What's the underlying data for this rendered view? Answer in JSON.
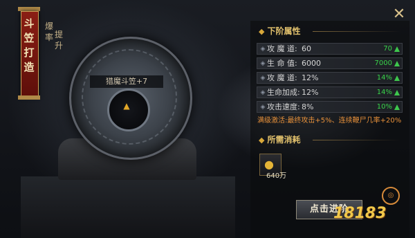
{
  "banner": {
    "title": "斗笠打造"
  },
  "subtitle": {
    "line1": "爆率",
    "line2": "提升"
  },
  "item": {
    "name": "猎魔斗笠+7",
    "icon": "hat-icon"
  },
  "next_attrs": {
    "title": "下阶属性",
    "rows": [
      {
        "label": "攻 魔 道:",
        "value": "60",
        "bonus": "70"
      },
      {
        "label": "生 命 值:",
        "value": "6000",
        "bonus": "7000"
      },
      {
        "label": "攻 魔 道:",
        "value": "12%",
        "bonus": "14%"
      },
      {
        "label": "生命加成:",
        "value": "12%",
        "bonus": "14%"
      },
      {
        "label": "攻击速度:",
        "value": "8%",
        "bonus": "10%"
      }
    ],
    "full_bonus": "满级激活:最终攻击+5%、连续鞭尸几率+20%"
  },
  "cost": {
    "title": "所需消耗",
    "amount": "640万",
    "icon": "gold-coin-icon"
  },
  "action": {
    "label": "点击进阶"
  },
  "close": {
    "icon": "close-icon",
    "glyph": "✕"
  },
  "watermark": {
    "text": "18183"
  },
  "colors": {
    "bonus_green": "#39d44a",
    "gold": "#e3c26d",
    "orange": "#e8913a"
  }
}
